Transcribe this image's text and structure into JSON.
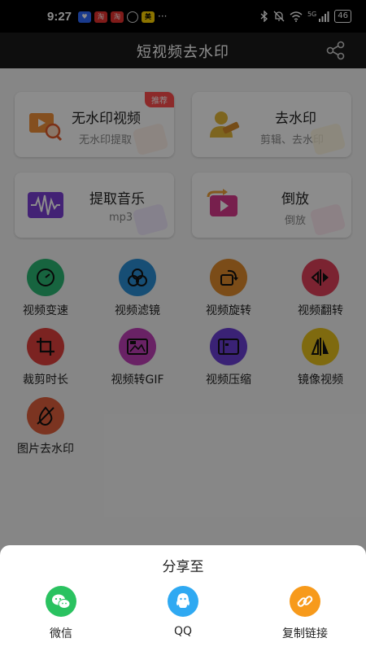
{
  "status_bar": {
    "time": "9:27",
    "notif_icons": [
      "淘",
      "淘",
      "美"
    ],
    "more": "···",
    "signal": "5G",
    "battery": "46"
  },
  "app_bar": {
    "title": "短视频去水印"
  },
  "feature_cards": [
    {
      "title": "无水印视频",
      "subtitle": "无水印提取",
      "tag": "推荐",
      "icon": "video-search-icon"
    },
    {
      "title": "去水印",
      "subtitle": "剪辑、去水印",
      "icon": "eraser-icon"
    },
    {
      "title": "提取音乐",
      "subtitle": "mp3",
      "icon": "audio-wave-icon"
    },
    {
      "title": "倒放",
      "subtitle": "倒放",
      "icon": "reverse-play-icon"
    }
  ],
  "tools": [
    {
      "label": "视频变速",
      "icon": "speed-gauge-icon",
      "color": "#2bb673"
    },
    {
      "label": "视频滤镜",
      "icon": "filter-icon",
      "color": "#2b8fd6"
    },
    {
      "label": "视频旋转",
      "icon": "rotate-icon",
      "color": "#e08a2c"
    },
    {
      "label": "视频翻转",
      "icon": "flip-icon",
      "color": "#e0405a"
    },
    {
      "label": "裁剪时长",
      "icon": "crop-icon",
      "color": "#e0403c"
    },
    {
      "label": "视频转GIF",
      "icon": "gif-icon",
      "color": "#c03fb8"
    },
    {
      "label": "视频压缩",
      "icon": "compress-icon",
      "color": "#6b3fd6"
    },
    {
      "label": "镜像视频",
      "icon": "mirror-icon",
      "color": "#e8c21c"
    },
    {
      "label": "图片去水印",
      "icon": "image-erase-icon",
      "color": "#e0603c"
    }
  ],
  "share_sheet": {
    "title": "分享至",
    "options": [
      {
        "label": "微信",
        "icon": "wechat-icon",
        "color": "#2ac260"
      },
      {
        "label": "QQ",
        "icon": "qq-icon",
        "color": "#2fa9f2"
      },
      {
        "label": "复制链接",
        "icon": "link-icon",
        "color": "#f79a1b"
      }
    ]
  }
}
